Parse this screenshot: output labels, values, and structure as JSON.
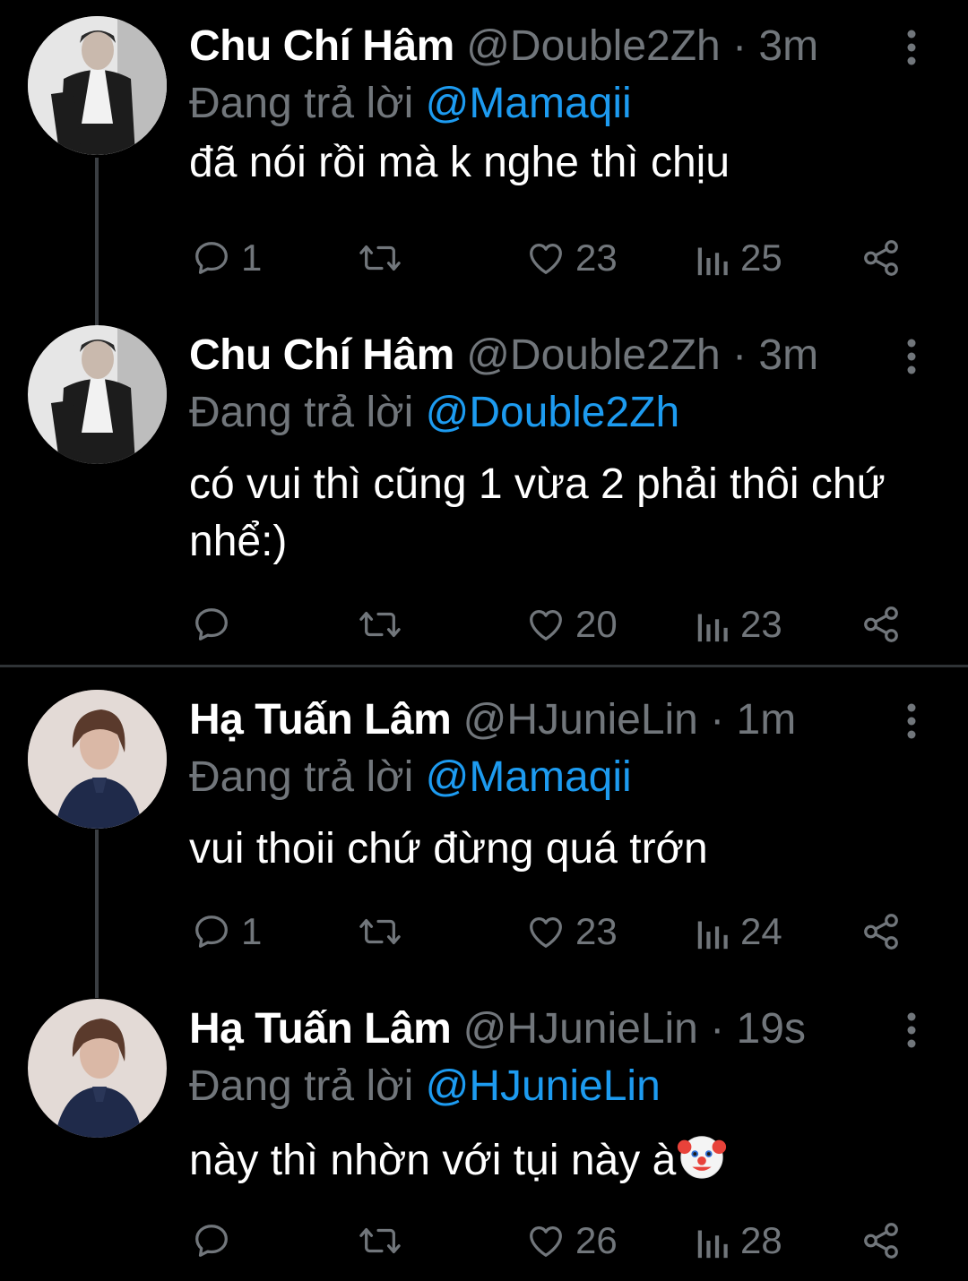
{
  "colors": {
    "background": "#000000",
    "name": "#ffffff",
    "muted": "#71767b",
    "mention": "#1d9bf0",
    "thread_line": "#3a3e42"
  },
  "tweets": [
    {
      "name": "Chu Chí Hâm",
      "handle": "@Double2Zh",
      "dot": "·",
      "time": "3m",
      "replying_prefix": "Đang trả lời",
      "replying_to": "@Mamaqii",
      "text": "đã nói rồi mà k nghe thì chịu",
      "replies": "1",
      "retweets": "",
      "likes": "23",
      "views": "25"
    },
    {
      "name": "Chu Chí Hâm",
      "handle": "@Double2Zh",
      "dot": "·",
      "time": "3m",
      "replying_prefix": "Đang trả lời",
      "replying_to": "@Double2Zh",
      "text": "có vui thì cũng 1 vừa 2 phải thôi chứ nhể:)",
      "replies": "",
      "retweets": "",
      "likes": "20",
      "views": "23"
    },
    {
      "name": "Hạ Tuấn Lâm",
      "handle": "@HJunieLin",
      "dot": "·",
      "time": "1m",
      "replying_prefix": "Đang trả lời",
      "replying_to": "@Mamaqii",
      "text": "vui thoii chứ đừng quá trớn",
      "replies": "1",
      "retweets": "",
      "likes": "23",
      "views": "24"
    },
    {
      "name": "Hạ Tuấn Lâm",
      "handle": "@HJunieLin",
      "dot": "·",
      "time": "19s",
      "replying_prefix": "Đang trả lời",
      "replying_to": "@HJunieLin",
      "text": "này thì nhờn với tụi này à",
      "text_emoji": "clown-face-emoji",
      "replies": "",
      "retweets": "",
      "likes": "26",
      "views": "28"
    }
  ],
  "icons": {
    "reply": "reply-bubble-icon",
    "retweet": "retweet-icon",
    "like": "heart-icon",
    "views": "views-bar-chart-icon",
    "share": "share-icon",
    "more": "more-vertical-icon"
  }
}
